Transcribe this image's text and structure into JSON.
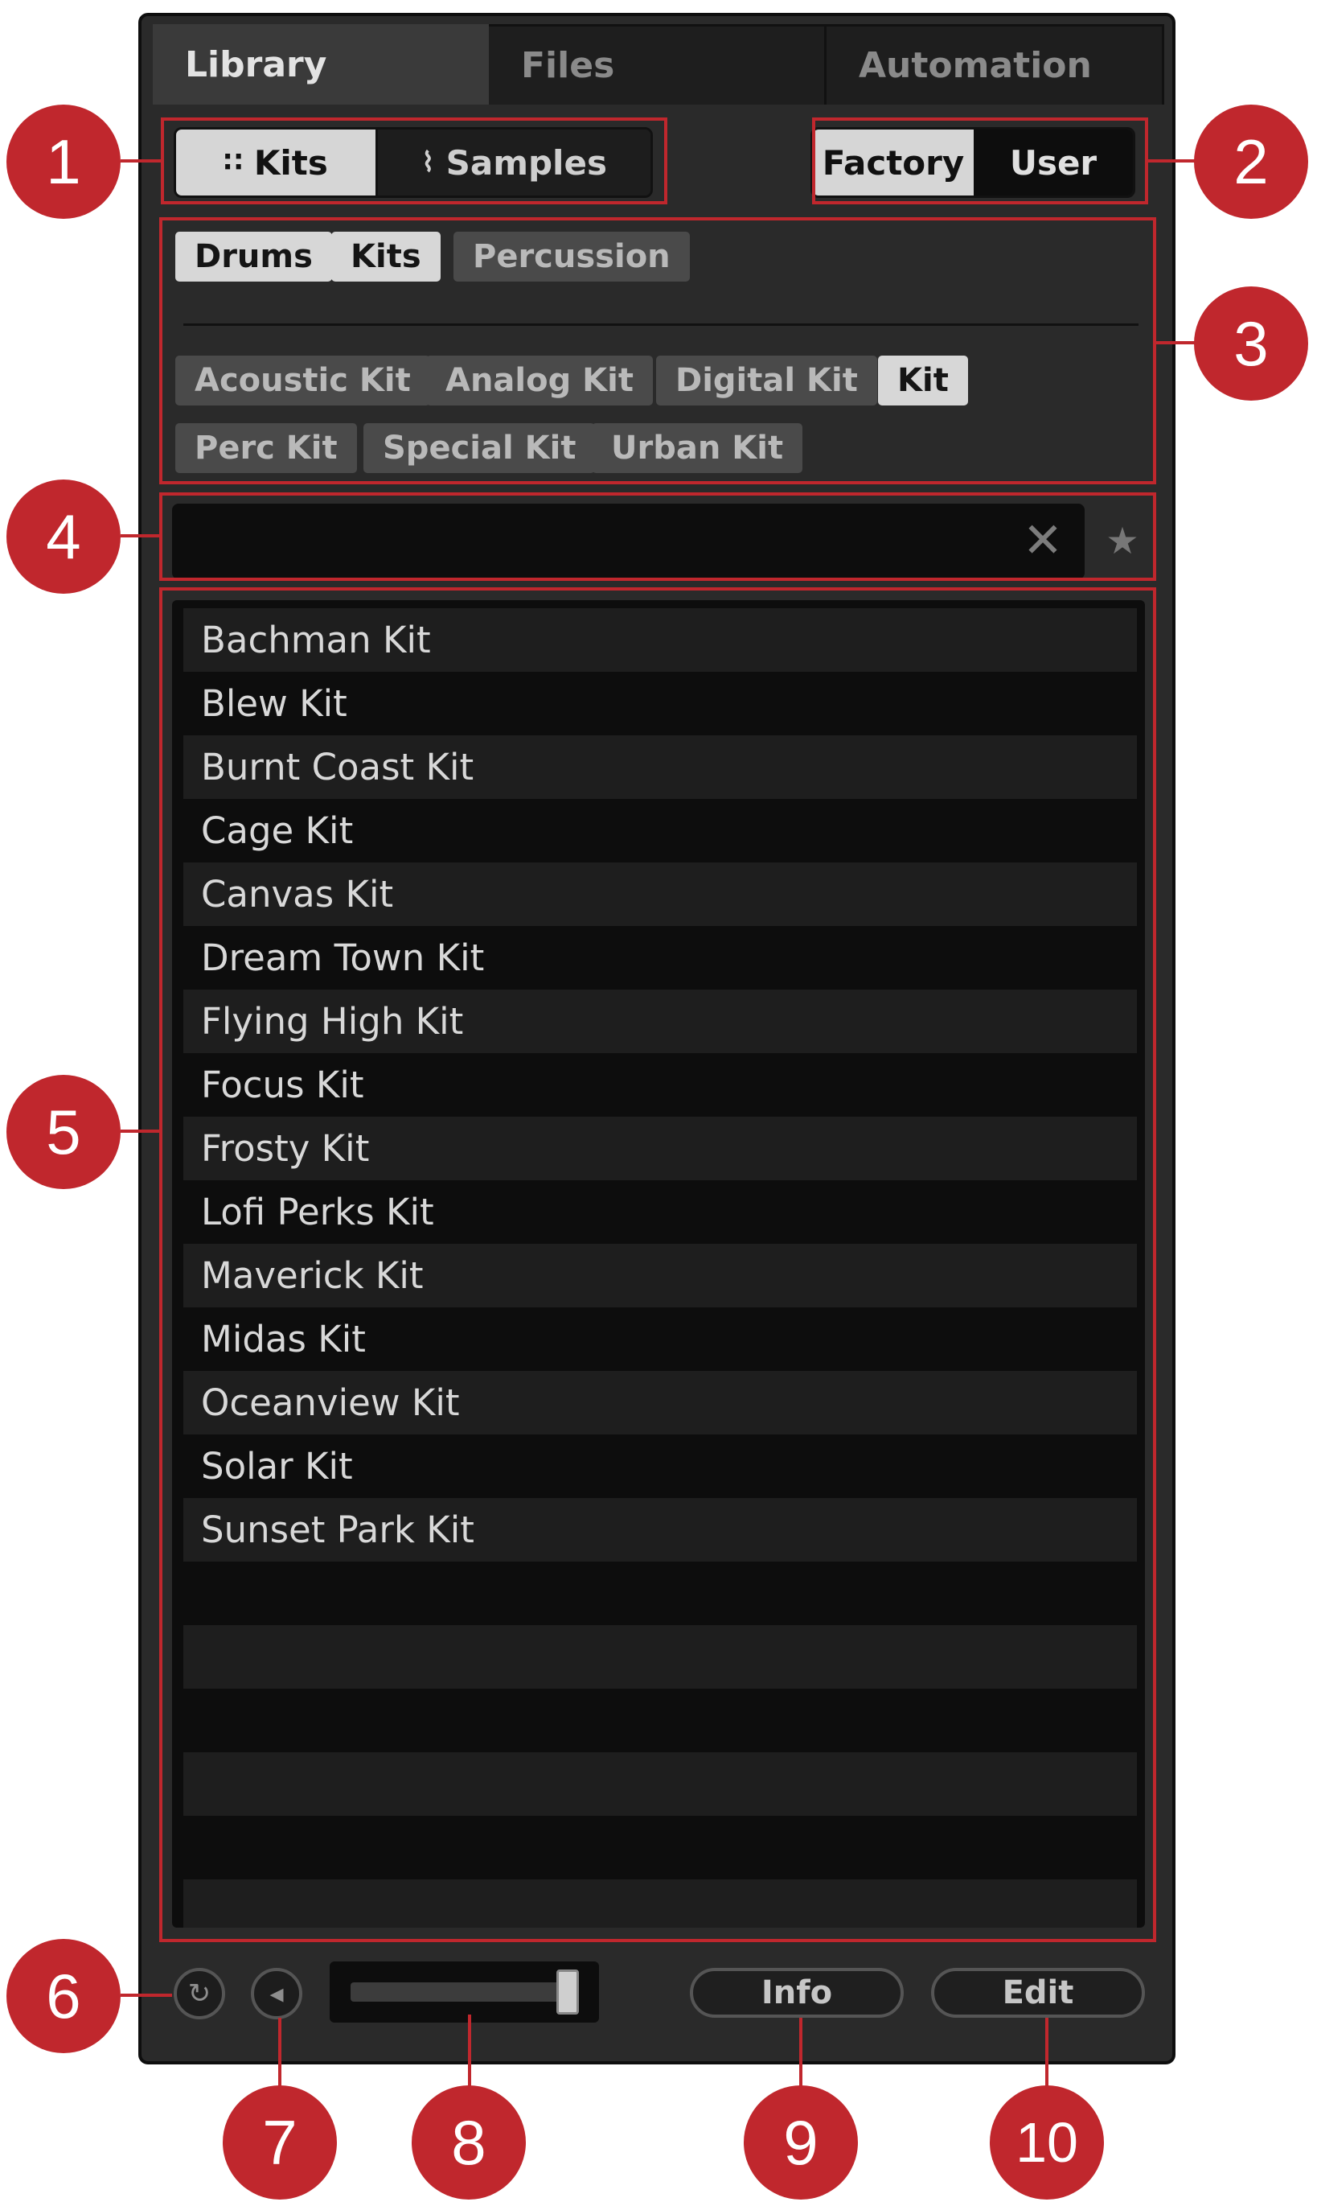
{
  "tabs": [
    {
      "label": "Library",
      "active": true
    },
    {
      "label": "Files",
      "active": false
    },
    {
      "label": "Automation",
      "active": false
    }
  ],
  "content_type": {
    "kits_label": "Kits",
    "kits_icon": "grid-icon",
    "samples_label": "Samples",
    "samples_icon": "waveform-icon",
    "selected": "Kits"
  },
  "source": {
    "factory_label": "Factory",
    "user_label": "User",
    "selected": "Factory"
  },
  "tags": {
    "row1": [
      {
        "label": "Drums",
        "selected": true
      },
      {
        "label": "Kits",
        "selected": true
      },
      {
        "label": "Percussion",
        "selected": false
      }
    ],
    "row2": [
      {
        "label": "Acoustic Kit",
        "selected": false
      },
      {
        "label": "Analog Kit",
        "selected": false
      },
      {
        "label": "Digital Kit",
        "selected": false
      },
      {
        "label": "Kit",
        "selected": true
      },
      {
        "label": "Perc Kit",
        "selected": false
      },
      {
        "label": "Special Kit",
        "selected": false
      },
      {
        "label": "Urban Kit",
        "selected": false
      }
    ]
  },
  "search": {
    "value": "",
    "clear_icon": "close-icon",
    "favorites_icon": "star-icon"
  },
  "results": [
    "Bachman Kit",
    "Blew Kit",
    "Burnt Coast Kit",
    "Cage Kit",
    "Canvas Kit",
    "Dream Town Kit",
    "Flying High Kit",
    "Focus Kit",
    "Frosty Kit",
    "Lofi Perks Kit",
    "Maverick Kit",
    "Midas Kit",
    "Oceanview Kit",
    "Solar Kit",
    "Sunset Park Kit"
  ],
  "footer": {
    "autoload_icon": "refresh-icon",
    "prehear_icon": "speaker-icon",
    "prehear_volume": 0.95,
    "info_label": "Info",
    "edit_label": "Edit"
  },
  "callouts": [
    "1",
    "2",
    "3",
    "4",
    "5",
    "6",
    "7",
    "8",
    "9",
    "10"
  ],
  "colors": {
    "accent": "#c0272d",
    "panel": "#2a2a2a",
    "list_bg": "#0d0d0d",
    "selected_tag": "#d7d7d7"
  }
}
